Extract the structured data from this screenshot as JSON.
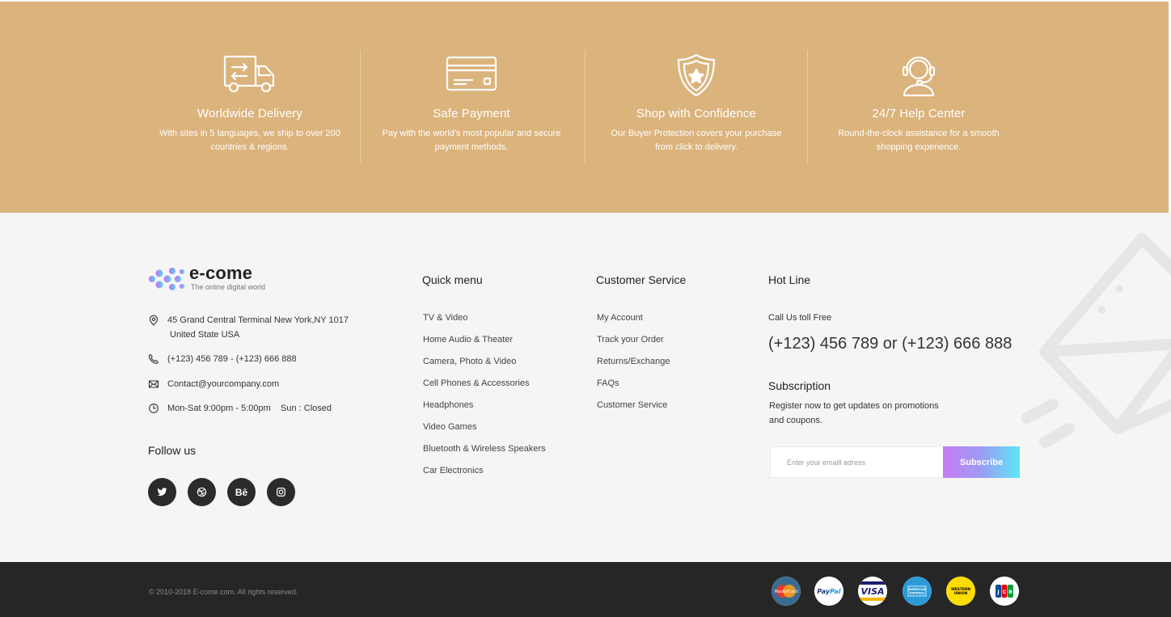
{
  "features": [
    {
      "icon": "delivery-truck-icon",
      "title": "Worldwide Delivery",
      "desc_line1": "With sites in 5 languages, we ship to over 200",
      "desc_line2": "countries & regions."
    },
    {
      "icon": "credit-card-icon",
      "title": "Safe Payment",
      "desc_line1": "Pay with the world's most popular and secure",
      "desc_line2": "payment methods."
    },
    {
      "icon": "shield-star-icon",
      "title": "Shop with Confidence",
      "desc_line1": "Our Buyer Protection covers your purchase",
      "desc_line2": "from click to delivery."
    },
    {
      "icon": "headset-support-icon",
      "title": "24/7 Help Center",
      "desc_line1": "Round-the-clock assistance for a smooth",
      "desc_line2": "shopping experience."
    }
  ],
  "brand": {
    "name": "e-come",
    "tagline": "The online digital world"
  },
  "contact": {
    "address_line1": "45 Grand Central Terminal New York,NY 1017",
    "address_line2": "United State USA",
    "phone": "(+123) 456 789 - (+123) 666 888",
    "email": "Contact@yourcompany.com",
    "hours": "Mon-Sat 9:00pm - 5:00pm    Sun : Closed"
  },
  "follow": {
    "title": "Follow us",
    "networks": [
      "twitter",
      "dribbble",
      "behance",
      "instagram"
    ],
    "behance_label": "Bē"
  },
  "quick_menu": {
    "title": "Quick menu",
    "items": [
      "TV & Video",
      "Home Audio & Theater",
      "Camera, Photo & Video",
      "Cell Phones & Accessories",
      "Headphones",
      "Video Games",
      "Bluetooth & Wireless Speakers",
      "Car Electronics"
    ]
  },
  "customer_service": {
    "title": "Customer Service",
    "items": [
      "My Account",
      "Track your Order",
      "Returns/Exchange",
      "FAQs",
      "Customer Service"
    ]
  },
  "hotline": {
    "title": "Hot Line",
    "label": "Call Us toll Free",
    "numbers": "(+123) 456 789 or (+123) 666 888"
  },
  "subscription": {
    "title": "Subscription",
    "desc_line1": "Register now to get updates on promotions",
    "desc_line2": "and coupons.",
    "placeholder": "Enter your emaill adress",
    "button": "Subscribe"
  },
  "bottom": {
    "copyright": "© 2010-2018 E-come.com. All rights reserved.",
    "payment_methods": [
      "MasterCard",
      "PayPal",
      "VISA",
      "American Express",
      "Western Union",
      "JCB"
    ]
  },
  "colors": {
    "feature_band": "#dbb37c",
    "footer_bg": "#f5f5f5",
    "bottom_bar": "#262626",
    "social_bg": "#2b2b2b"
  }
}
